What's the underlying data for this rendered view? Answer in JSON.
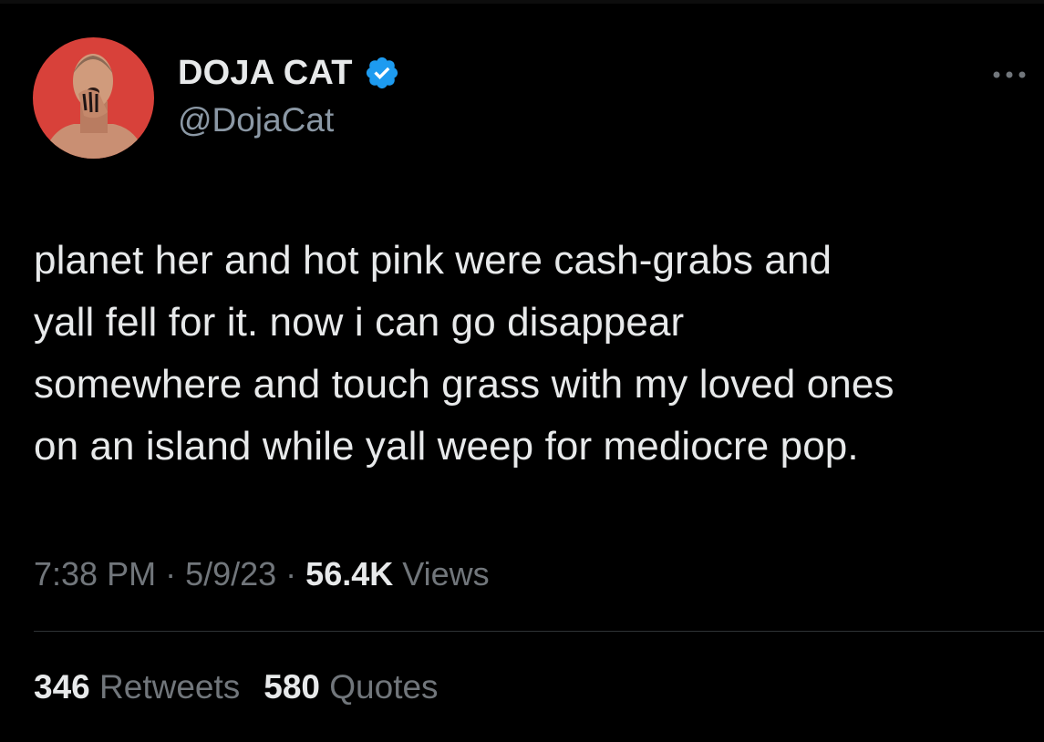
{
  "author": {
    "display_name": "DOJA CAT",
    "handle": "@DojaCat",
    "verified": true,
    "avatar_icon": "profile-photo",
    "verified_color": "#1d9bf0"
  },
  "tweet": {
    "text": "planet her and hot pink were cash-grabs and\nyall fell for it. now i can go disappear\nsomewhere and touch grass with my loved ones\non an island while yall weep for mediocre pop."
  },
  "meta": {
    "time": "7:38 PM",
    "separator": " · ",
    "date": "5/9/23",
    "views_count": "56.4K",
    "views_label": "Views"
  },
  "stats": {
    "retweets_count": "346",
    "retweets_label": "Retweets",
    "quotes_count": "580",
    "quotes_label": "Quotes"
  },
  "colors": {
    "background": "#000000",
    "primary_text": "#e7e9ea",
    "secondary_text": "#71767b",
    "divider": "#2f3336",
    "avatar_background": "#d8413a"
  }
}
